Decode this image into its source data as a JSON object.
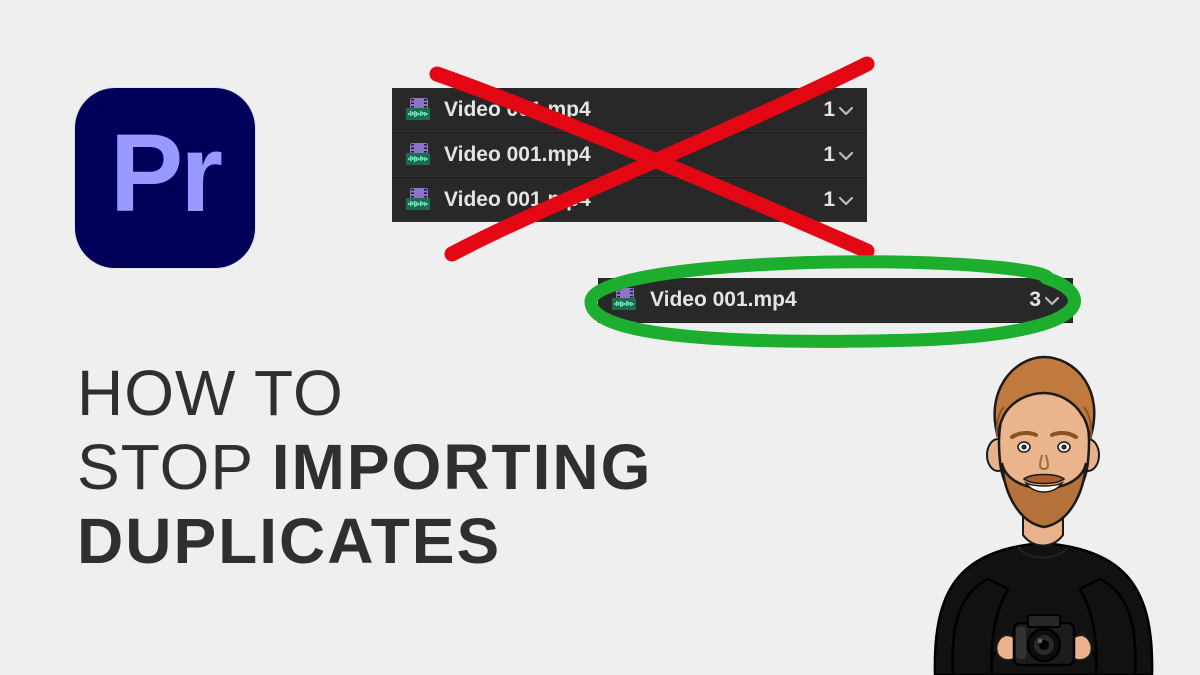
{
  "app_icon": {
    "label": "Pr"
  },
  "headline": {
    "line1": "HOW TO",
    "line2_a": "STOP ",
    "line2_b": "IMPORTING",
    "line3": "DUPLICATES"
  },
  "duplicates_panel": {
    "rows": [
      {
        "filename": "Video 001.mp4",
        "usage_count": "1"
      },
      {
        "filename": "Video 001.mp4",
        "usage_count": "1"
      },
      {
        "filename": "Video 001.mp4",
        "usage_count": "1"
      }
    ]
  },
  "consolidated_panel": {
    "row": {
      "filename": "Video 001.mp4",
      "usage_count": "3"
    }
  },
  "colors": {
    "accent_red": "#e30613",
    "accent_green": "#1eae2f",
    "pr_bg": "#00005b",
    "pr_fg": "#9999ff",
    "panel_bg": "#282828",
    "panel_text": "#e4e4e4"
  }
}
